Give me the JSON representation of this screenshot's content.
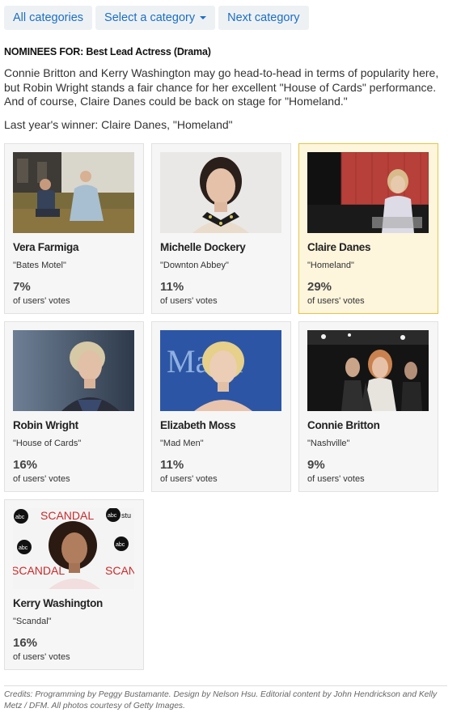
{
  "nav": {
    "all_label": "All categories",
    "select_label": "Select a category",
    "next_label": "Next category"
  },
  "heading": "NOMINEES FOR: Best Lead Actress (Drama)",
  "intro": "Connie Britton and Kerry Washington may go head-to-head in terms of popularity here, but Robin Wright stands a fair chance for her excellent \"House of Cards\" performance. And of course, Claire Danes could be back on stage for \"Homeland.\"",
  "last_winner": "Last year's winner: Claire Danes, \"Homeland\"",
  "nominees": [
    {
      "name": "Vera Farmiga",
      "show": "\"Bates Motel\"",
      "percent": "7%",
      "votes_label": "of users' votes",
      "selected": false
    },
    {
      "name": "Michelle Dockery",
      "show": "\"Downton Abbey\"",
      "percent": "11%",
      "votes_label": "of users' votes",
      "selected": false
    },
    {
      "name": "Claire Danes",
      "show": "\"Homeland\"",
      "percent": "29%",
      "votes_label": "of users' votes",
      "selected": true
    },
    {
      "name": "Robin Wright",
      "show": "\"House of Cards\"",
      "percent": "16%",
      "votes_label": "of users' votes",
      "selected": false
    },
    {
      "name": "Elizabeth Moss",
      "show": "\"Mad Men\"",
      "percent": "11%",
      "votes_label": "of users' votes",
      "selected": false
    },
    {
      "name": "Connie Britton",
      "show": "\"Nashville\"",
      "percent": "9%",
      "votes_label": "of users' votes",
      "selected": false
    },
    {
      "name": "Kerry Washington",
      "show": "\"Scandal\"",
      "percent": "16%",
      "votes_label": "of users' votes",
      "selected": false
    }
  ],
  "photo_text": {
    "moss_backdrop": "Ma    ra",
    "scandal_1": "SCANDAL",
    "scandal_2": "SCANDAL",
    "scandal_3": "SCAN",
    "abc_1": "abc",
    "abc_2": "abc",
    "abc_3": "abc",
    "abc_4": "abc",
    "studio_fragment": "stu"
  },
  "credits": "Credits: Programming by Peggy Bustamante. Design by Nelson Hsu. Editorial content by John Hendrickson and Kelly Metz / DFM. All photos courtesy of Getty Images.",
  "colors": {
    "link": "#1a6fc4",
    "nav_bg": "#eef1f4",
    "card_bg": "#f6f6f6",
    "selected_bg": "#fdf5dc",
    "selected_border": "#e8c444"
  }
}
